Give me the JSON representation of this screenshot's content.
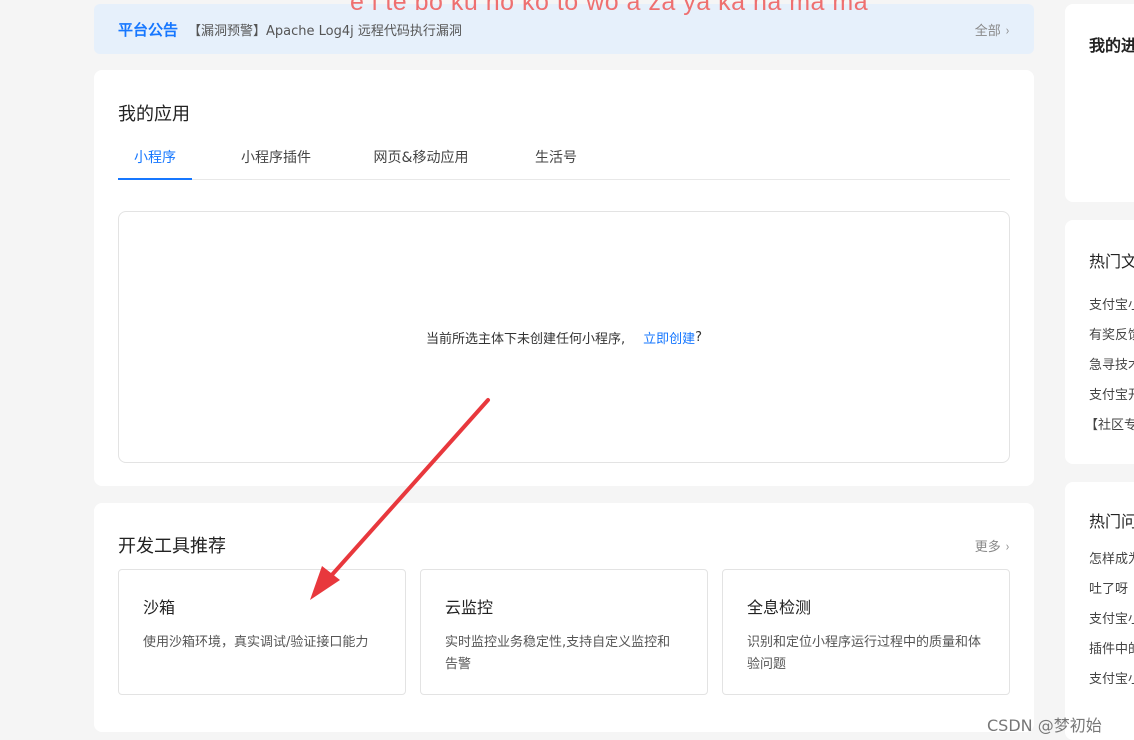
{
  "overlay_text": "e i te bo ku no ko to wo a za ya ka na ma ma",
  "notice": {
    "label": "平台公告",
    "text": "【漏洞预警】Apache Log4j 远程代码执行漏洞",
    "all_label": "全部",
    "chevron": "›"
  },
  "apps": {
    "title": "我的应用",
    "tabs": [
      {
        "label": "小程序"
      },
      {
        "label": "小程序插件"
      },
      {
        "label": "网页&移动应用"
      },
      {
        "label": "生活号"
      }
    ],
    "empty_text": "当前所选主体下未创建任何小程序,",
    "create_link": "立即创建",
    "question_mark": "?"
  },
  "tools": {
    "title": "开发工具推荐",
    "more_label": "更多",
    "items": [
      {
        "title": "沙箱",
        "desc": "使用沙箱环境，真实调试/验证接口能力"
      },
      {
        "title": "云监控",
        "desc": "实时监控业务稳定性,支持自定义监控和告警"
      },
      {
        "title": "全息检测",
        "desc": "识别和定位小程序运行过程中的质量和体验问题"
      }
    ]
  },
  "right": {
    "card1_title": "我的进",
    "card2_title": "热门文",
    "card2_items": [
      "支付宝小",
      "有奖反馈",
      "急寻技术",
      "支付宝开",
      "【社区专"
    ],
    "card3_title": "热门问",
    "card3_items": [
      "怎样成为",
      "吐了呀",
      "支付宝小",
      "插件中的",
      "支付宝小"
    ]
  },
  "watermark": "CSDN @梦初始",
  "colors": {
    "accent": "#1677ff",
    "arrow": "#e8383d",
    "notice_bg": "#e6f0fb",
    "overlay_text": "#ee7070"
  }
}
